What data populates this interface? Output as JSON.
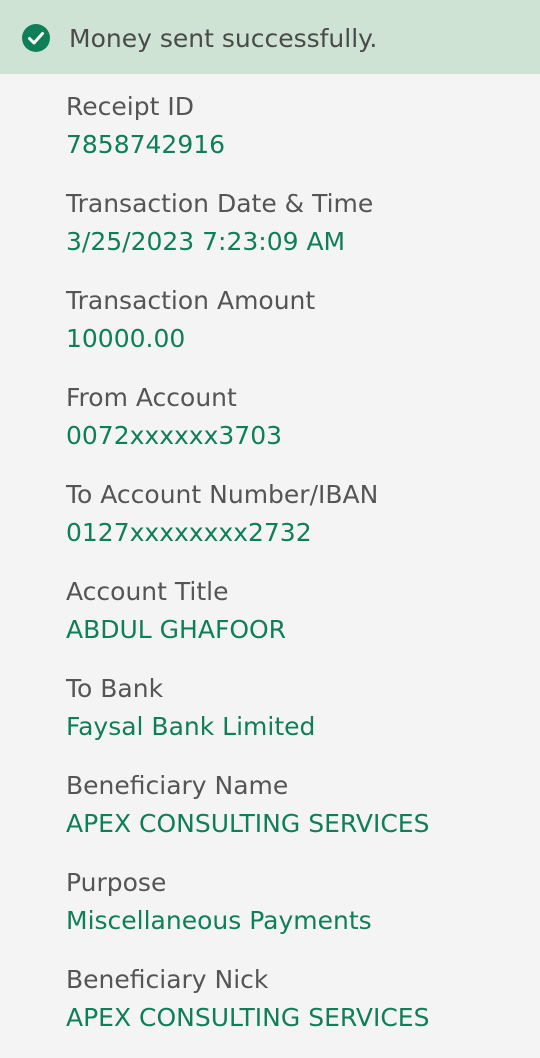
{
  "banner": {
    "icon": "check-circle-icon",
    "message": "Money sent successfully.",
    "background_color": "#cfe3d4",
    "icon_color": "#0f7f58"
  },
  "colors": {
    "label": "#555555",
    "value": "#0f7f58",
    "background": "#f4f4f4"
  },
  "fields": [
    {
      "label": "Receipt ID",
      "value": "7858742916"
    },
    {
      "label": "Transaction Date & Time",
      "value": "3/25/2023 7:23:09 AM"
    },
    {
      "label": "Transaction Amount",
      "value": "10000.00"
    },
    {
      "label": "From Account",
      "value": "0072xxxxxx3703"
    },
    {
      "label": "To Account Number/IBAN",
      "value": "0127xxxxxxxx2732"
    },
    {
      "label": "Account Title",
      "value": "ABDUL GHAFOOR"
    },
    {
      "label": "To Bank",
      "value": "Faysal Bank Limited"
    },
    {
      "label": "Beneficiary Name",
      "value": "APEX CONSULTING SERVICES"
    },
    {
      "label": "Purpose",
      "value": "Miscellaneous Payments"
    },
    {
      "label": "Beneficiary Nick",
      "value": "APEX CONSULTING SERVICES"
    }
  ]
}
